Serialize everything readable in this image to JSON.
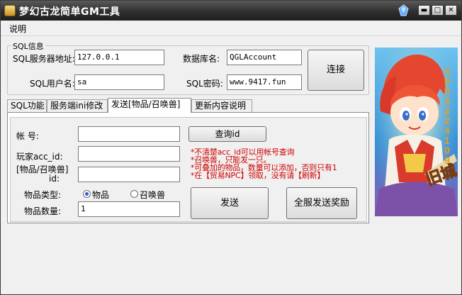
{
  "window": {
    "title": "梦幻古龙简单GM工具"
  },
  "titlebar_buttons": {
    "minimize": "▬",
    "maximize": "□",
    "close": "✕"
  },
  "menu": {
    "items": [
      "说明"
    ]
  },
  "sql_group": {
    "legend": "SQL信息",
    "server_label": "SQL服务器地址:",
    "server_value": "127.0.0.1",
    "db_label": "数据库名:",
    "db_value": "QGLAccount",
    "user_label": "SQL用户名:",
    "user_value": "sa",
    "password_label": "SQL密码:",
    "password_value": "www.9417.fun"
  },
  "connect_label": "连接",
  "banner": {
    "side_text": "4954224109",
    "badge": "旧城"
  },
  "tabs": [
    {
      "label": "SQL功能"
    },
    {
      "label": "服务端ini修改"
    },
    {
      "label": "发送[物品/召唤兽]"
    },
    {
      "label": "更新内容说明"
    }
  ],
  "send_panel": {
    "account_label": "帐      号:",
    "account_value": "",
    "acc_id_label": "玩家acc_id:",
    "acc_id_value": "",
    "item_id_label_1": "[物品/召唤兽]",
    "item_id_label_2": "id:",
    "item_id_value": "",
    "query_button": "查询id",
    "notes": [
      "*不清楚acc_id可以用帐号查询",
      "*召唤兽，只能发一只。",
      "*可叠加的物品，数量可以添加，否则只有1",
      "*在【贸易NPC】领取，没有请【刷新】"
    ],
    "type_label": "物品类型:",
    "type_options": [
      "物品",
      "召唤兽"
    ],
    "type_selected": "物品",
    "qty_label": "物品数量:",
    "qty_value": "1",
    "send_button": "发送",
    "send_all_button": "全服发送奖励"
  },
  "colors": {
    "titlebar": "#2f2f2f",
    "note_red": "#d00000",
    "radio_dot": "#2a5fd1"
  }
}
